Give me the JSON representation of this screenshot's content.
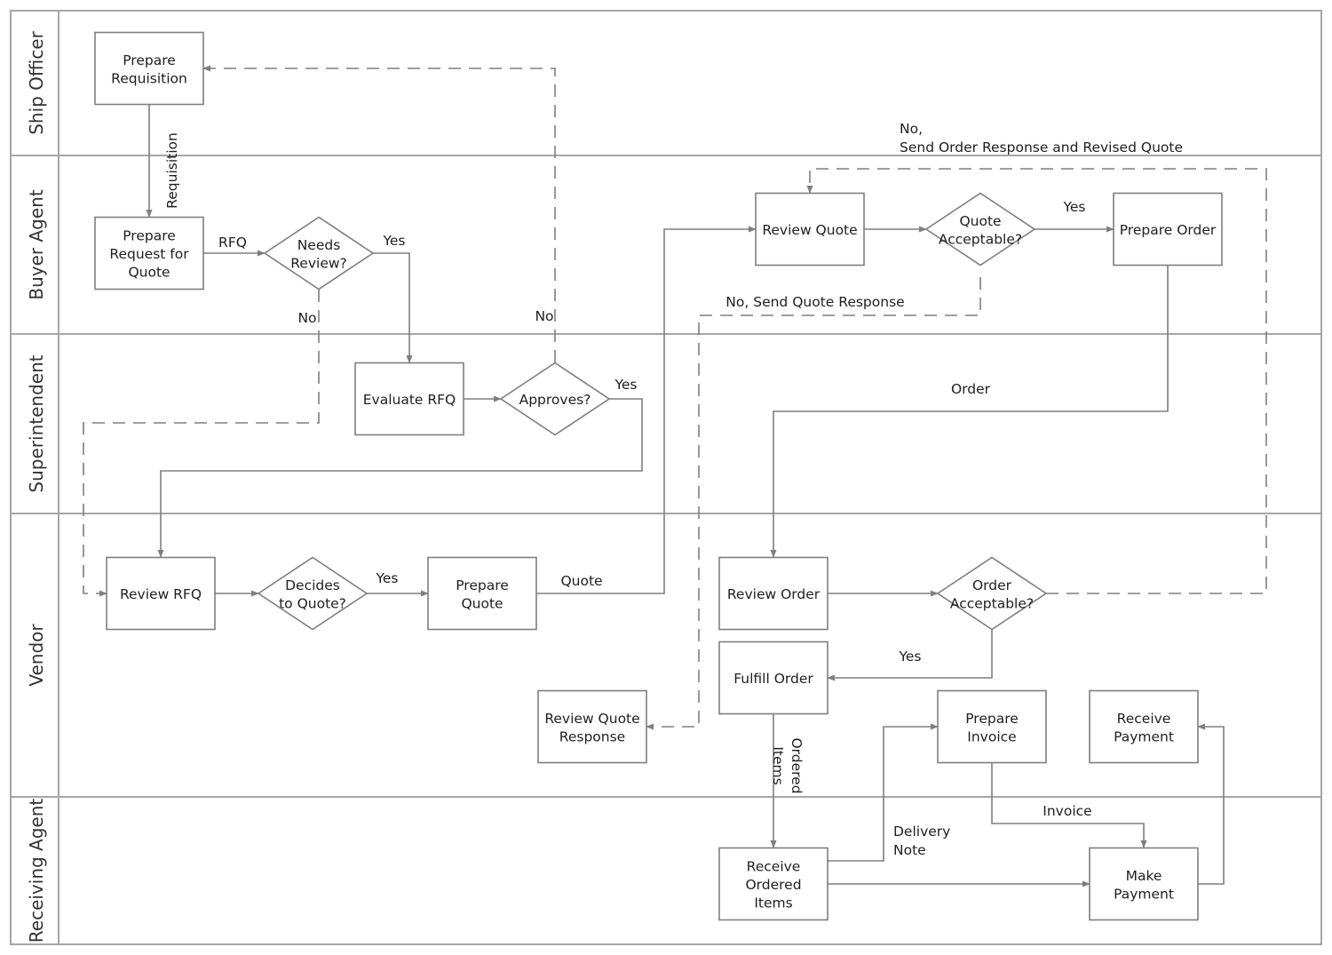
{
  "diagram": {
    "type": "cross-functional flowchart",
    "lanes": [
      {
        "id": "ship-officer",
        "label": "Ship Officer"
      },
      {
        "id": "buyer-agent",
        "label": "Buyer Agent"
      },
      {
        "id": "superintendent",
        "label": "Superintendent"
      },
      {
        "id": "vendor",
        "label": "Vendor"
      },
      {
        "id": "receiving-agent",
        "label": "Receiving Agent"
      }
    ],
    "nodes": [
      {
        "id": "prepare-requisition",
        "shape": "process",
        "lane": "ship-officer",
        "lines": [
          "Prepare",
          "Requisition"
        ]
      },
      {
        "id": "prepare-rfq",
        "shape": "process",
        "lane": "buyer-agent",
        "lines": [
          "Prepare",
          "Request for",
          "Quote"
        ]
      },
      {
        "id": "needs-review",
        "shape": "decision",
        "lane": "buyer-agent",
        "lines": [
          "Needs",
          "Review?"
        ]
      },
      {
        "id": "review-quote",
        "shape": "process",
        "lane": "buyer-agent",
        "lines": [
          "Review Quote"
        ]
      },
      {
        "id": "quote-acceptable",
        "shape": "decision",
        "lane": "buyer-agent",
        "lines": [
          "Quote",
          "Acceptable?"
        ]
      },
      {
        "id": "prepare-order",
        "shape": "process",
        "lane": "buyer-agent",
        "lines": [
          "Prepare Order"
        ]
      },
      {
        "id": "evaluate-rfq",
        "shape": "process",
        "lane": "superintendent",
        "lines": [
          "Evaluate RFQ"
        ]
      },
      {
        "id": "approves",
        "shape": "decision",
        "lane": "superintendent",
        "lines": [
          "Approves?"
        ]
      },
      {
        "id": "review-rfq",
        "shape": "process",
        "lane": "vendor",
        "lines": [
          "Review RFQ"
        ]
      },
      {
        "id": "decides-to-quote",
        "shape": "decision",
        "lane": "vendor",
        "lines": [
          "Decides",
          "to Quote?"
        ]
      },
      {
        "id": "prepare-quote",
        "shape": "process",
        "lane": "vendor",
        "lines": [
          "Prepare",
          "Quote"
        ]
      },
      {
        "id": "review-quote-response",
        "shape": "process",
        "lane": "vendor",
        "lines": [
          "Review Quote",
          "Response"
        ]
      },
      {
        "id": "review-order",
        "shape": "process",
        "lane": "vendor",
        "lines": [
          "Review Order"
        ]
      },
      {
        "id": "order-acceptable",
        "shape": "decision",
        "lane": "vendor",
        "lines": [
          "Order",
          "Acceptable?"
        ]
      },
      {
        "id": "fulfill-order",
        "shape": "process",
        "lane": "vendor",
        "lines": [
          "Fulfill Order"
        ]
      },
      {
        "id": "prepare-invoice",
        "shape": "process",
        "lane": "vendor",
        "lines": [
          "Prepare",
          "Invoice"
        ]
      },
      {
        "id": "receive-payment",
        "shape": "process",
        "lane": "vendor",
        "lines": [
          "Receive",
          "Payment"
        ]
      },
      {
        "id": "receive-ordered-items",
        "shape": "process",
        "lane": "receiving-agent",
        "lines": [
          "Receive",
          "Ordered",
          "Items"
        ]
      },
      {
        "id": "make-payment",
        "shape": "process",
        "lane": "receiving-agent",
        "lines": [
          "Make",
          "Payment"
        ]
      }
    ],
    "edges": [
      {
        "from": "prepare-requisition",
        "to": "prepare-rfq",
        "label": "Requisition",
        "style": "solid"
      },
      {
        "from": "prepare-rfq",
        "to": "needs-review",
        "label": "RFQ",
        "style": "solid"
      },
      {
        "from": "needs-review",
        "to": "evaluate-rfq",
        "label": "Yes",
        "style": "solid"
      },
      {
        "from": "needs-review",
        "to": "review-rfq",
        "label": "No",
        "style": "dashed"
      },
      {
        "from": "evaluate-rfq",
        "to": "approves",
        "label": "",
        "style": "solid"
      },
      {
        "from": "approves",
        "to": "prepare-requisition",
        "label": "No",
        "style": "dashed"
      },
      {
        "from": "approves",
        "to": "review-rfq",
        "label": "Yes",
        "style": "solid"
      },
      {
        "from": "review-rfq",
        "to": "decides-to-quote",
        "label": "",
        "style": "solid"
      },
      {
        "from": "decides-to-quote",
        "to": "prepare-quote",
        "label": "Yes",
        "style": "solid"
      },
      {
        "from": "prepare-quote",
        "to": "review-quote",
        "label": "Quote",
        "style": "solid"
      },
      {
        "from": "review-quote",
        "to": "quote-acceptable",
        "label": "",
        "style": "solid"
      },
      {
        "from": "quote-acceptable",
        "to": "prepare-order",
        "label": "Yes",
        "style": "solid"
      },
      {
        "from": "quote-acceptable",
        "to": "review-quote-response",
        "label": "No, Send Quote Response",
        "style": "dashed"
      },
      {
        "from": "prepare-order",
        "to": "review-order",
        "label": "Order",
        "style": "solid"
      },
      {
        "from": "review-order",
        "to": "order-acceptable",
        "label": "",
        "style": "solid"
      },
      {
        "from": "order-acceptable",
        "to": "review-quote",
        "label": "No,\nSend Order Response and Revised Quote",
        "style": "dashed"
      },
      {
        "from": "order-acceptable",
        "to": "fulfill-order",
        "label": "Yes",
        "style": "solid"
      },
      {
        "from": "fulfill-order",
        "to": "receive-ordered-items",
        "label": "Ordered\nItems",
        "style": "solid"
      },
      {
        "from": "receive-ordered-items",
        "to": "prepare-invoice",
        "label": "Delivery\nNote",
        "style": "solid"
      },
      {
        "from": "receive-ordered-items",
        "to": "make-payment",
        "label": "",
        "style": "solid"
      },
      {
        "from": "prepare-invoice",
        "to": "make-payment",
        "label": "Invoice",
        "style": "solid"
      },
      {
        "from": "make-payment",
        "to": "receive-payment",
        "label": "",
        "style": "solid"
      }
    ]
  },
  "colors": {
    "stroke": "#7f7f7f",
    "frame": "#a6a6a6",
    "text": "#1f1f1f",
    "background": "#ffffff"
  }
}
